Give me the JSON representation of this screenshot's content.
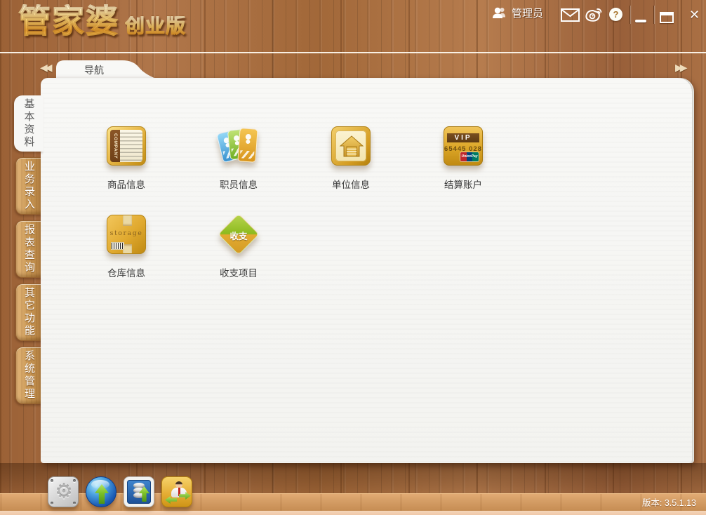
{
  "app": {
    "logo_main": "管家婆",
    "logo_sub": "创业版",
    "version": "版本: 3.5.1.13"
  },
  "header": {
    "user_label": "管理员",
    "help_glyph": "?",
    "close_glyph": "✕"
  },
  "nav": {
    "tab_label": "导航",
    "scroll_left_glyph": "◀◀",
    "scroll_right_glyph": "▶▶"
  },
  "sidebar": {
    "tabs": [
      {
        "label": "基本资料",
        "active": true
      },
      {
        "label": "业务录入",
        "active": false
      },
      {
        "label": "报表查询",
        "active": false
      },
      {
        "label": "其它功能",
        "active": false
      },
      {
        "label": "系统管理",
        "active": false
      }
    ]
  },
  "main": {
    "items": [
      {
        "label": "商品信息",
        "icon": "product-document-icon",
        "icon_text": "COMPANY"
      },
      {
        "label": "职员信息",
        "icon": "employee-id-cards-icon"
      },
      {
        "label": "单位信息",
        "icon": "company-building-icon"
      },
      {
        "label": "结算账户",
        "icon": "vip-bank-card-icon",
        "card_title": "VIP",
        "card_number": "65445 028",
        "card_brand": "UnionPay"
      },
      {
        "label": "仓库信息",
        "icon": "storage-box-icon",
        "icon_text": "storage"
      },
      {
        "label": "收支项目",
        "icon": "income-expense-diamond-icon",
        "icon_text": "收支"
      }
    ]
  },
  "taskbar": {
    "items": [
      {
        "name": "settings",
        "icon": "gear-icon"
      },
      {
        "name": "online-update",
        "icon": "globe-upload-icon"
      },
      {
        "name": "data-upgrade",
        "icon": "database-upload-icon"
      },
      {
        "name": "user-transfer",
        "icon": "user-transfer-icon"
      }
    ]
  },
  "colors": {
    "wood_base": "#a3693e",
    "panel_bg": "#f6f6f4",
    "sidebar_tab_gold": "#cb9a57",
    "logo_gold": "#fbd87c",
    "desk": "#d59e66",
    "bottom_strip": "#f6d6ba",
    "arrow_green": "#7cc228"
  }
}
